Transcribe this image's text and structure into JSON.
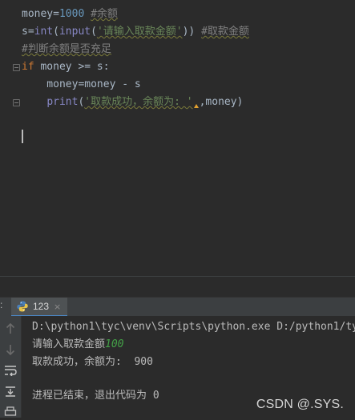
{
  "editor": {
    "top_partial": "# ------ -----",
    "lines": [
      {
        "parts": [
          {
            "t": "money=",
            "c": ""
          },
          {
            "t": "1000",
            "c": "num"
          },
          {
            "t": " ",
            "c": ""
          },
          {
            "t": "#余额",
            "c": "cmt"
          }
        ]
      },
      {
        "parts": [
          {
            "t": "s=",
            "c": ""
          },
          {
            "t": "int",
            "c": "fn"
          },
          {
            "t": "(",
            "c": ""
          },
          {
            "t": "input",
            "c": "fn"
          },
          {
            "t": "(",
            "c": ""
          },
          {
            "t": "'请输入取款金额'",
            "c": "str"
          },
          {
            "t": ")) ",
            "c": ""
          },
          {
            "t": "#取款金额",
            "c": "cmt"
          }
        ]
      },
      {
        "parts": [
          {
            "t": "#判断余额是否充足",
            "c": "cmt"
          }
        ]
      },
      {
        "parts": [
          {
            "t": "if",
            "c": "kw"
          },
          {
            "t": " money >= s:",
            "c": ""
          }
        ]
      },
      {
        "parts": [
          {
            "t": "    money=money - s",
            "c": ""
          }
        ]
      },
      {
        "parts": [
          {
            "t": "    ",
            "c": ""
          },
          {
            "t": "print",
            "c": "fn"
          },
          {
            "t": "(",
            "c": ""
          },
          {
            "t": "'取款成功，余额为: '",
            "c": "str"
          },
          {
            "t": ",",
            "c": ""
          },
          {
            "t": "money)",
            "c": ""
          }
        ]
      }
    ]
  },
  "run_panel": {
    "label_stub": ":",
    "tab_label": "123",
    "tab_close": "×",
    "toolbar_icons": [
      "arrow-up-icon",
      "arrow-down-icon",
      "soft-wrap-icon",
      "scroll-to-end-icon",
      "print-icon"
    ]
  },
  "console": {
    "command": "D:\\python1\\tyc\\venv\\Scripts\\python.exe D:/python1/tyc",
    "prompt": "请输入取款金额",
    "prompt_input": "100",
    "result": "取款成功，余额为:  900",
    "exit": "进程已结束，退出代码为 0"
  },
  "watermark": "CSDN @.SYS."
}
